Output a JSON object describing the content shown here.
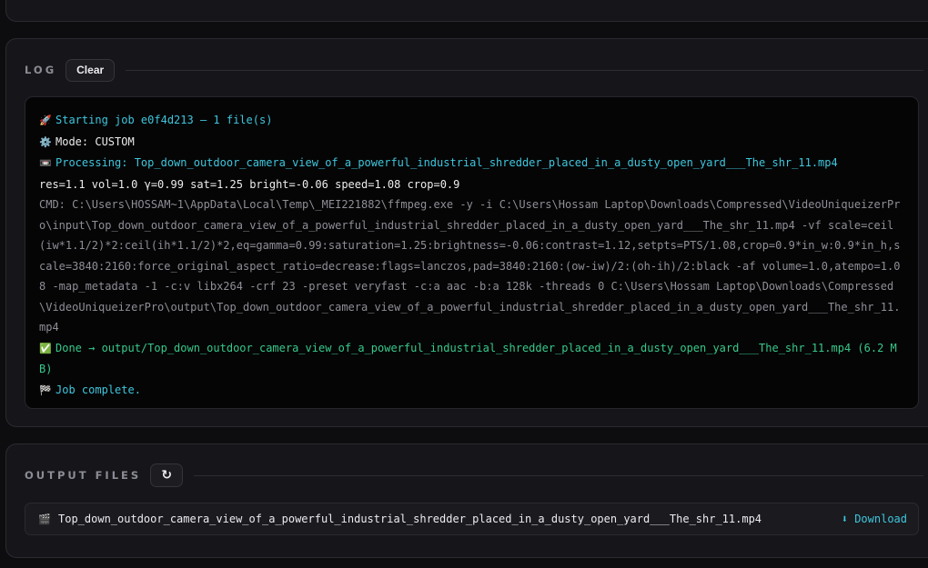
{
  "log": {
    "title": "LOG",
    "clear_label": "Clear",
    "lines": [
      {
        "icon": "🚀",
        "text": "Starting job e0f4d213 — 1 file(s)",
        "color": "cyan"
      },
      {
        "icon": "⚙️",
        "text": "Mode: CUSTOM",
        "color": "white"
      },
      {
        "icon": "📼",
        "text": "Processing: Top_down_outdoor_camera_view_of_a_powerful_industrial_shredder_placed_in_a_dusty_open_yard___The_shr_11.mp4",
        "color": "cyan"
      },
      {
        "icon": "",
        "text": "res=1.1 vol=1.0 γ=0.99 sat=1.25 bright=-0.06 speed=1.08 crop=0.9",
        "color": "white"
      },
      {
        "icon": "",
        "text": "CMD: C:\\Users\\HOSSAM~1\\AppData\\Local\\Temp\\_MEI221882\\ffmpeg.exe -y -i C:\\Users\\Hossam Laptop\\Downloads\\Compressed\\VideoUniqueizerPro\\input\\Top_down_outdoor_camera_view_of_a_powerful_industrial_shredder_placed_in_a_dusty_open_yard___The_shr_11.mp4 -vf scale=ceil(iw*1.1/2)*2:ceil(ih*1.1/2)*2,eq=gamma=0.99:saturation=1.25:brightness=-0.06:contrast=1.12,setpts=PTS/1.08,crop=0.9*in_w:0.9*in_h,scale=3840:2160:force_original_aspect_ratio=decrease:flags=lanczos,pad=3840:2160:(ow-iw)/2:(oh-ih)/2:black -af volume=1.0,atempo=1.08 -map_metadata -1 -c:v libx264 -crf 23 -preset veryfast -c:a aac -b:a 128k -threads 0 C:\\Users\\Hossam Laptop\\Downloads\\Compressed\\VideoUniqueizerPro\\output\\Top_down_outdoor_camera_view_of_a_powerful_industrial_shredder_placed_in_a_dusty_open_yard___The_shr_11.mp4",
        "color": "dim"
      },
      {
        "icon": "✅",
        "text": "Done → output/Top_down_outdoor_camera_view_of_a_powerful_industrial_shredder_placed_in_a_dusty_open_yard___The_shr_11.mp4 (6.2 MB)",
        "color": "green"
      },
      {
        "icon": "🏁",
        "text": "Job complete.",
        "color": "cyan"
      }
    ]
  },
  "output": {
    "title": "OUTPUT FILES",
    "refresh_icon": "↻",
    "files": [
      {
        "icon": "🎬",
        "name": "Top_down_outdoor_camera_view_of_a_powerful_industrial_shredder_placed_in_a_dusty_open_yard___The_shr_11.mp4",
        "download_label": "⬇ Download"
      }
    ]
  },
  "colors": {
    "cyan": "#3fc6dc",
    "green": "#38c98a",
    "dim": "#8e8e96",
    "white": "#ececec"
  }
}
